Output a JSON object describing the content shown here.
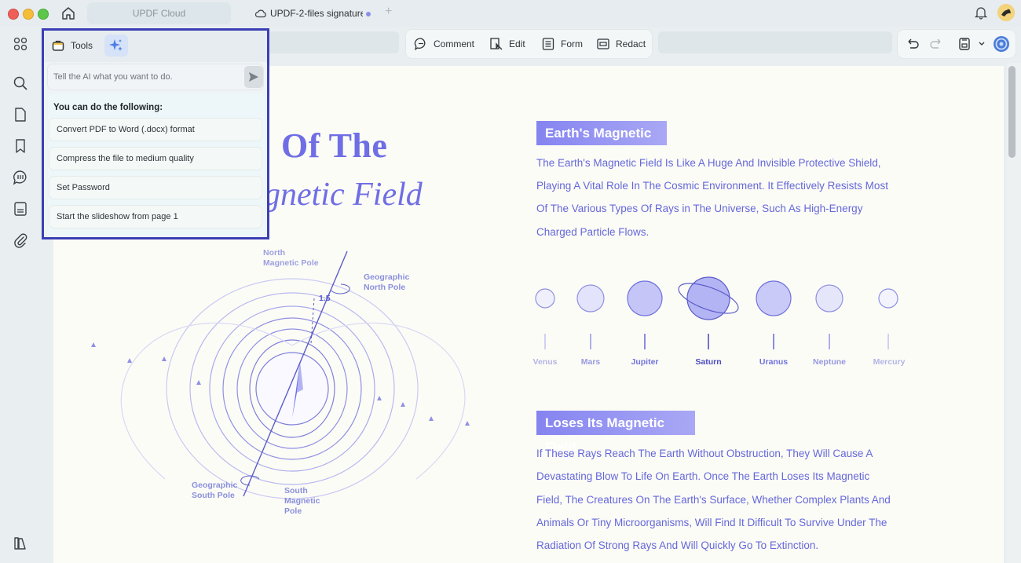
{
  "tabs": {
    "cloud": "UPDF Cloud",
    "file": "UPDF-2-files signature"
  },
  "toolbar": {
    "comment": "Comment",
    "edit": "Edit",
    "form": "Form",
    "redact": "Redact"
  },
  "ai_panel": {
    "tools_label": "Tools",
    "input_placeholder": "Tell the AI what you want to do.",
    "suggestions_title": "You can do the following:",
    "suggestions": [
      "Convert PDF to Word (.docx) format",
      "Compress the file to medium quality",
      "Set Password",
      "Start the slideshow from page 1"
    ]
  },
  "document": {
    "heading_part1": "Of The",
    "heading_part2": "gnetic Field",
    "section1": {
      "title": "Earth's Magnetic",
      "lines": [
        "The Earth's Magnetic Field Is Like A Huge And Invisible Protective Shield,",
        "Playing A Vital Role In The Cosmic Environment. It Effectively Resists Most",
        "Of The Various Types Of Rays in The Universe, Such As High-Energy",
        "Charged Particle Flows."
      ]
    },
    "planets": [
      "Venus",
      "Mars",
      "Jupiter",
      "Saturn",
      "Uranus",
      "Neptune",
      "Mercury"
    ],
    "section2": {
      "title": "Loses Its Magnetic Field",
      "lines": [
        "If These Rays Reach The Earth Without Obstruction, They Will Cause A",
        "Devastating Blow To Life On Earth. Once The Earth Loses Its Magnetic",
        "Field, The Creatures On The Earth's Surface, Whether Complex Plants And",
        "Animals Or Tiny Microorganisms, Will Find It Difficult To Survive Under The",
        "Radiation Of Strong Rays And Will Quickly Go To Extinction."
      ]
    },
    "diagram": {
      "north_magnetic_pole": [
        "North",
        "Magnetic Pole"
      ],
      "geographic_north_pole": [
        "Geographic",
        "North Pole"
      ],
      "angle": "1.5",
      "geographic_south_pole": [
        "Geographic",
        "South Pole"
      ],
      "south_magnetic_pole": [
        "South",
        "Magnetic",
        "Pole"
      ]
    }
  },
  "colors": {
    "accent": "#6f6ee5",
    "text_blue": "#6467db",
    "panel_border": "#3b3fb4"
  }
}
